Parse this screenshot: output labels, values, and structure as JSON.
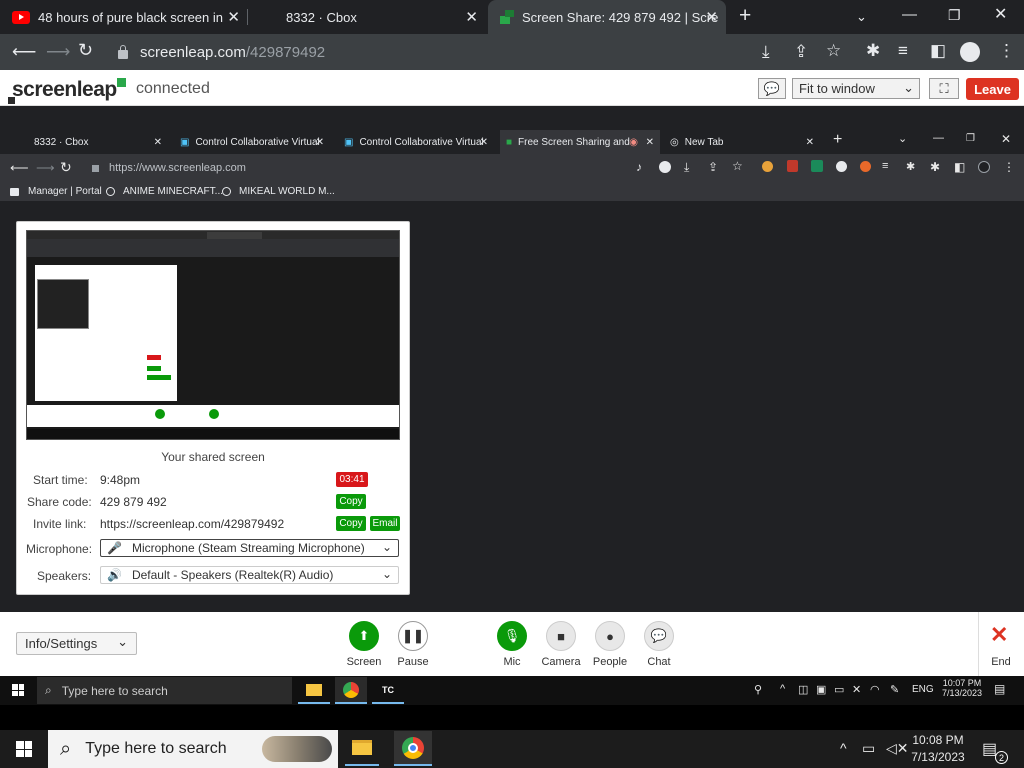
{
  "outer_browser": {
    "tabs": [
      {
        "title": "48 hours of pure black screen in",
        "close": "✕"
      },
      {
        "title": "8332 · Cbox",
        "close": "✕"
      },
      {
        "title": "Screen Share: 429 879 492 | Scre",
        "close": "✕"
      }
    ],
    "new_tab": "+",
    "url_domain": "screenleap.com",
    "url_path": "/429879492",
    "window_controls": {
      "minimize": "—",
      "restore": "❐",
      "close": "✕"
    }
  },
  "screenleap_bar": {
    "logo": "screenleap",
    "status": "connected",
    "fit_select": "Fit to window",
    "leave_label": "Leave"
  },
  "inner_browser": {
    "tabs": [
      {
        "title": "8332 · Cbox"
      },
      {
        "title": "Control Collaborative Virtual"
      },
      {
        "title": "Control Collaborative Virtual"
      },
      {
        "title": "Free Screen Sharing and"
      },
      {
        "title": "New Tab"
      }
    ],
    "url": "https://www.screenleap.com",
    "bookmarks": [
      "Manager | Portal",
      "ANIME MINECRAFT...",
      "MIKEAL WORLD M..."
    ]
  },
  "share_panel": {
    "caption": "Your shared screen",
    "start_time_label": "Start time:",
    "start_time_value": "9:48pm",
    "timer": "03:41",
    "share_code_label": "Share code:",
    "share_code_value": "429 879 492",
    "invite_label": "Invite link:",
    "invite_value": "https://screenleap.com/429879492",
    "copy_label": "Copy",
    "email_label": "Email",
    "microphone_label": "Microphone:",
    "microphone_value": "Microphone (Steam Streaming Microphone)",
    "speakers_label": "Speakers:",
    "speakers_value": "Default - Speakers (Realtek(R) Audio)"
  },
  "controls": {
    "info_settings": "Info/Settings",
    "screen": "Screen",
    "pause": "Pause",
    "mic": "Mic",
    "camera": "Camera",
    "people": "People",
    "chat": "Chat",
    "end": "End"
  },
  "inner_taskbar": {
    "search_placeholder": "Type here to search",
    "lang": "ENG",
    "time": "10:07 PM",
    "date": "7/13/2023"
  },
  "outer_taskbar": {
    "search_placeholder": "Type here to search",
    "time": "10:08 PM",
    "date": "7/13/2023",
    "notification_count": "2"
  },
  "colors": {
    "accent_green": "#0a9a0a",
    "leave_red": "#dd3322",
    "timer_red": "#d8171a"
  }
}
